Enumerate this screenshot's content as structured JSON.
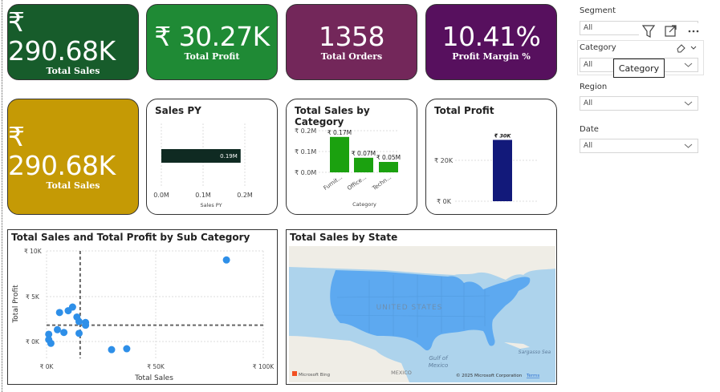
{
  "kpis": [
    {
      "value": "₹ 290.68K",
      "label": "Total Sales",
      "color": "#175C2B"
    },
    {
      "value": "₹ 30.27K",
      "label": "Total Profit",
      "color": "#1F8A35"
    },
    {
      "value": "1358",
      "label": "Total Orders",
      "color": "#73275A"
    },
    {
      "value": "10.41%",
      "label": "Profit Margin %",
      "color": "#57105E"
    },
    {
      "value": "₹ 290.68K",
      "label": "Total Sales",
      "color": "#C59A05"
    }
  ],
  "slicers": {
    "segment": {
      "header": "Segment",
      "value": "All"
    },
    "category": {
      "header": "Category",
      "value": "All",
      "tooltip": "Category"
    },
    "region": {
      "header": "Region",
      "value": "All"
    },
    "date": {
      "header": "Date",
      "value": "All"
    }
  },
  "visuals": {
    "sales_py": {
      "title": "Sales PY"
    },
    "sales_by_category": {
      "title": "Total Sales by Category"
    },
    "total_profit": {
      "title": "Total Profit"
    },
    "scatter": {
      "title": "Total Sales and Total Profit by Sub Category"
    },
    "map": {
      "title": "Total Sales by State",
      "country_label": "UNITED STATES",
      "mexico_label": "MEXICO",
      "gulf_label_1": "Gulf of",
      "gulf_label_2": "Mexico",
      "sea_label": "Sargasso Sea",
      "provider": "Microsoft Bing",
      "copyright": "© 2025 Microsoft Corporation",
      "terms": "Terms",
      "fill_color": "#5DA9F0"
    }
  },
  "chart_data": [
    {
      "type": "bar",
      "orientation": "horizontal",
      "title": "Sales PY",
      "categories": [
        ""
      ],
      "values": [
        0.19
      ],
      "data_labels": [
        "0.19M"
      ],
      "x_ticks": [
        "0.0M",
        "0.1M",
        "0.2M"
      ],
      "xlim": [
        0,
        0.2
      ],
      "xlabel": "Sales PY",
      "color": "#0F2A22"
    },
    {
      "type": "bar",
      "title": "Total Sales by Category",
      "categories": [
        "Furnit...",
        "Office...",
        "Techn..."
      ],
      "values": [
        0.17,
        0.07,
        0.05
      ],
      "data_labels": [
        "₹ 0.17M",
        "₹ 0.07M",
        "₹ 0.05M"
      ],
      "y_ticks": [
        "₹ 0.0M",
        "₹ 0.1M",
        "₹ 0.2M"
      ],
      "ylim": [
        0,
        0.2
      ],
      "xlabel": "Category",
      "color": "#1BA10F"
    },
    {
      "type": "bar",
      "title": "Total Profit",
      "categories": [
        ""
      ],
      "values": [
        30
      ],
      "data_labels": [
        "₹ 30K"
      ],
      "y_ticks": [
        "₹ 0K",
        "₹ 20K"
      ],
      "ylim": [
        0,
        35
      ],
      "color": "#12197A"
    },
    {
      "type": "scatter",
      "title": "Total Sales and Total Profit by Sub Category",
      "xlabel": "Total Sales",
      "ylabel": "Total Profit",
      "x_ticks": [
        "₹ 0K",
        "₹ 50K",
        "₹ 100K"
      ],
      "y_ticks": [
        "₹ 0K",
        "₹ 5K",
        "₹ 10K"
      ],
      "xlim": [
        0,
        100
      ],
      "ylim": [
        -1.5,
        10
      ],
      "reference_x": 15.5,
      "reference_y": 1.8,
      "color": "#2E8FE8",
      "points": [
        {
          "x": 83,
          "y": 9.0
        },
        {
          "x": 1,
          "y": 0.8
        },
        {
          "x": 1,
          "y": 0.2
        },
        {
          "x": 2,
          "y": -0.2
        },
        {
          "x": 5,
          "y": 1.3
        },
        {
          "x": 6,
          "y": 3.2
        },
        {
          "x": 8,
          "y": 1.0
        },
        {
          "x": 10,
          "y": 3.4
        },
        {
          "x": 12,
          "y": 3.8
        },
        {
          "x": 14,
          "y": 2.7
        },
        {
          "x": 15,
          "y": 2.2
        },
        {
          "x": 15,
          "y": 0.9
        },
        {
          "x": 18,
          "y": 2.1
        },
        {
          "x": 18,
          "y": 1.8
        },
        {
          "x": 30,
          "y": -0.9
        },
        {
          "x": 37,
          "y": -0.8
        }
      ]
    }
  ]
}
